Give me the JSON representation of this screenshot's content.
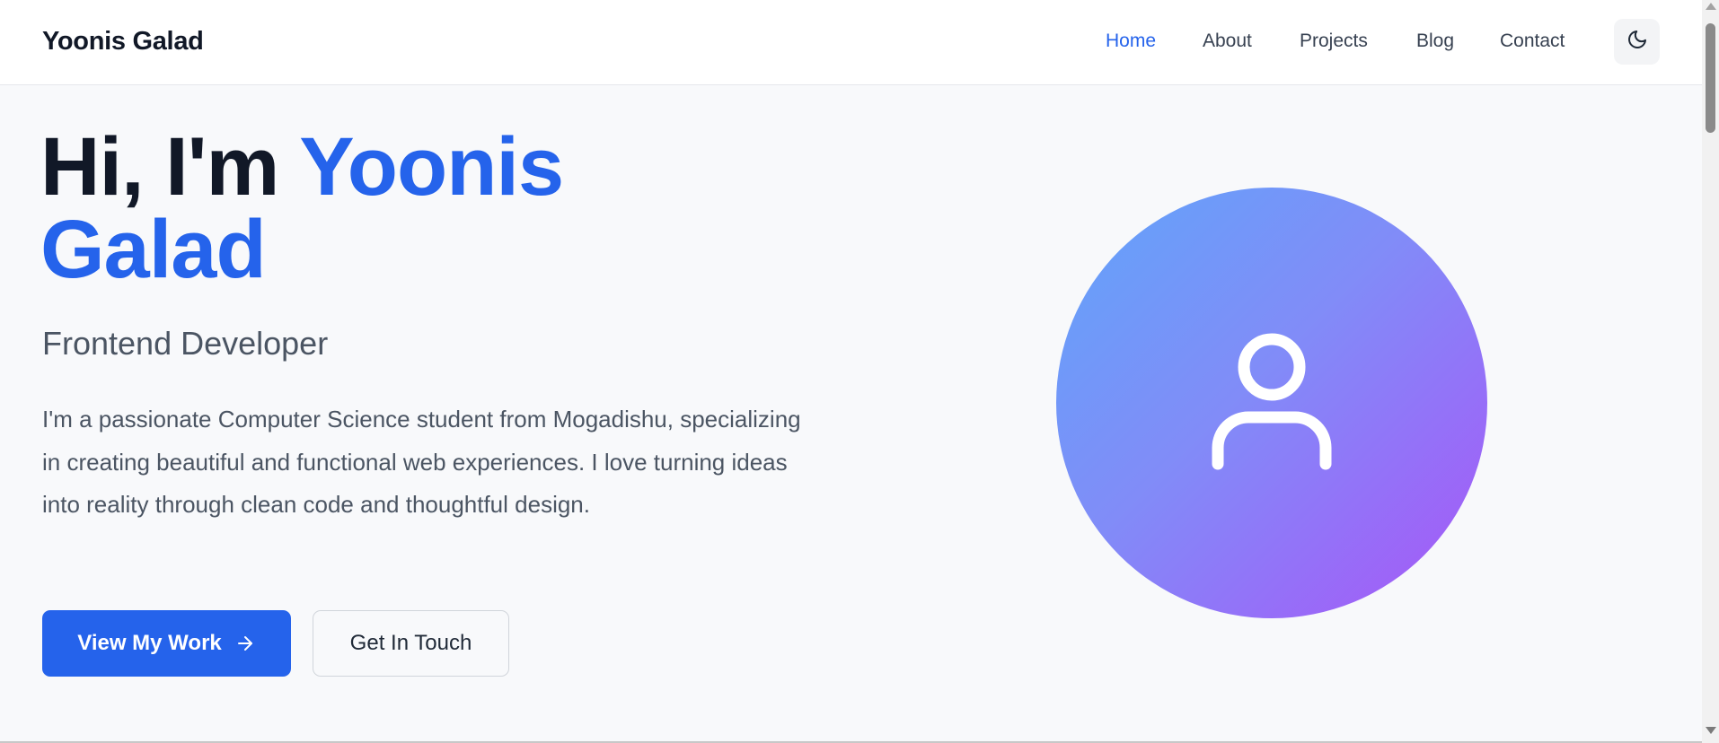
{
  "header": {
    "brand": "Yoonis Galad",
    "nav": [
      {
        "label": "Home",
        "active": true
      },
      {
        "label": "About",
        "active": false
      },
      {
        "label": "Projects",
        "active": false
      },
      {
        "label": "Blog",
        "active": false
      },
      {
        "label": "Contact",
        "active": false
      }
    ],
    "theme_toggle_icon": "moon-icon"
  },
  "hero": {
    "greeting": "Hi, I'm ",
    "name_first": "Yoonis",
    "name_last": "Galad",
    "subtitle": "Frontend Developer",
    "bio": "I'm a passionate Computer Science student from Mogadishu, specializing in creating beautiful and functional web experiences. I love turning ideas into reality through clean code and thoughtful design.",
    "primary_button": "View My Work",
    "primary_button_icon": "arrow-right-icon",
    "secondary_button": "Get In Touch",
    "avatar_icon": "user-icon"
  },
  "colors": {
    "accent": "#2563eb",
    "heading": "#111827",
    "body_text": "#4b5563",
    "avatar_gradient_start": "#60a5fa",
    "avatar_gradient_end": "#a855f7"
  }
}
